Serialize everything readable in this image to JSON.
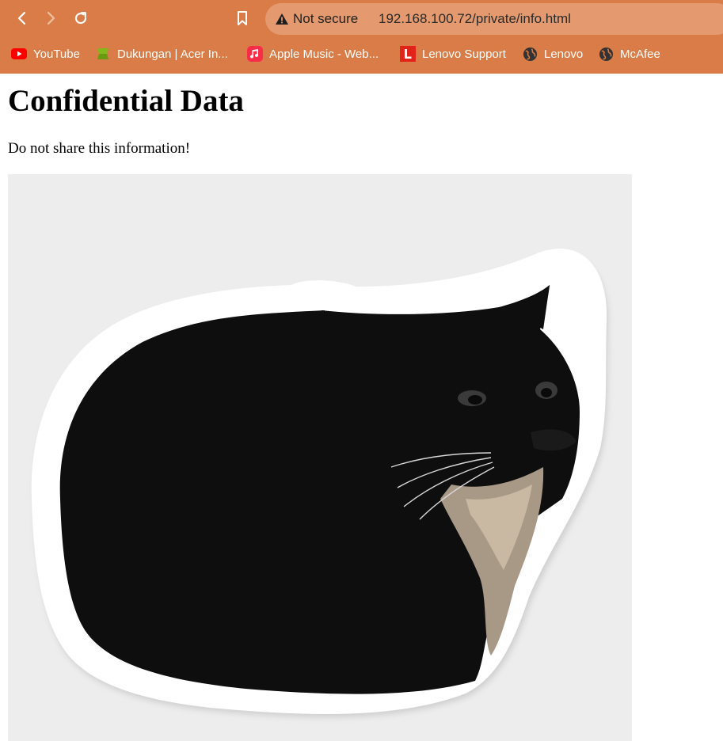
{
  "browser": {
    "security_label": "Not secure",
    "url": "192.168.100.72/private/info.html",
    "bookmarks": [
      {
        "label": "YouTube",
        "icon": "youtube-icon",
        "color": "#ff0000"
      },
      {
        "label": "Dukungan | Acer In...",
        "icon": "acer-icon",
        "color": "#83b81a"
      },
      {
        "label": "Apple Music - Web...",
        "icon": "apple-music-icon",
        "color": "#fa2d48"
      },
      {
        "label": "Lenovo Support",
        "icon": "lenovo-l-icon",
        "color": "#e2231a"
      },
      {
        "label": "Lenovo",
        "icon": "globe-icon",
        "color": "#333333"
      },
      {
        "label": "McAfee",
        "icon": "globe-icon",
        "color": "#333333"
      }
    ],
    "chrome_color": "#d97c47"
  },
  "page": {
    "heading": "Confidential Data",
    "note": "Do not share this information!",
    "image": "cat-sticker"
  }
}
